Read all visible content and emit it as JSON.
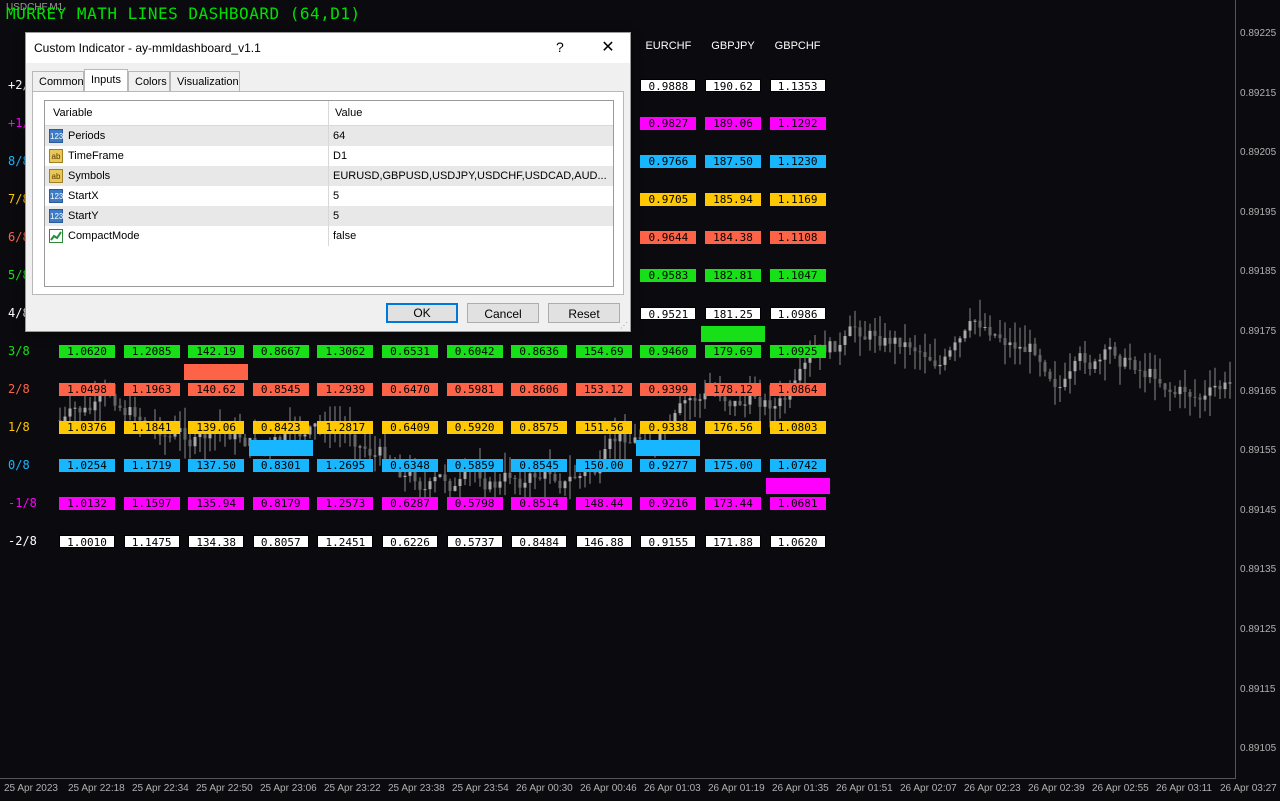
{
  "window": {
    "symbol_tag": "USDCHF,M1",
    "dashboard_title": "MURREY MATH LINES DASHBOARD (64,D1)"
  },
  "price_axis": [
    "0.89225",
    "0.89215",
    "0.89205",
    "0.89195",
    "0.89185",
    "0.89175",
    "0.89165",
    "0.89155",
    "0.89145",
    "0.89135",
    "0.89125",
    "0.89115",
    "0.89105"
  ],
  "time_axis": [
    "25 Apr 2023",
    "25 Apr 22:18",
    "25 Apr 22:34",
    "25 Apr 22:50",
    "25 Apr 23:06",
    "25 Apr 23:22",
    "25 Apr 23:38",
    "25 Apr 23:54",
    "26 Apr 00:30",
    "26 Apr 00:46",
    "26 Apr 01:03",
    "26 Apr 01:19",
    "26 Apr 01:35",
    "26 Apr 01:51",
    "26 Apr 02:07",
    "26 Apr 02:23",
    "26 Apr 02:39",
    "26 Apr 02:55",
    "26 Apr 03:11",
    "26 Apr 03:27"
  ],
  "dashboard": {
    "headers": [
      "",
      "",
      "",
      "",
      "",
      "",
      "",
      "",
      "",
      "EURCHF",
      "GBPJPY",
      "GBPCHF"
    ],
    "levels": [
      {
        "label": "+2/8",
        "color": "#ffffff",
        "bg": "#ffffff",
        "fg": "#000000",
        "values": [
          "",
          "",
          "",
          "",
          "",
          "",
          "",
          "",
          "",
          "0.9888",
          "190.62",
          "1.1353"
        ]
      },
      {
        "label": "+1/8",
        "color": "#ff00ff",
        "bg": "#ff00ff",
        "fg": "#000000",
        "values": [
          "",
          "",
          "",
          "",
          "",
          "",
          "",
          "",
          "",
          "0.9827",
          "189.06",
          "1.1292"
        ]
      },
      {
        "label": "8/8",
        "color": "#17b6ff",
        "bg": "#17b6ff",
        "fg": "#000000",
        "values": [
          "",
          "",
          "",
          "",
          "",
          "",
          "",
          "",
          "",
          "0.9766",
          "187.50",
          "1.1230"
        ]
      },
      {
        "label": "7/8",
        "color": "#ffc800",
        "bg": "#ffc800",
        "fg": "#000000",
        "values": [
          "",
          "",
          "",
          "",
          "",
          "",
          "",
          "",
          "",
          "0.9705",
          "185.94",
          "1.1169"
        ]
      },
      {
        "label": "6/8",
        "color": "#ff6347",
        "bg": "#ff6347",
        "fg": "#000000",
        "values": [
          "",
          "",
          "",
          "",
          "",
          "",
          "",
          "",
          "",
          "0.9644",
          "184.38",
          "1.1108"
        ]
      },
      {
        "label": "5/8",
        "color": "#18e018",
        "bg": "#18e018",
        "fg": "#000000",
        "values": [
          "",
          "",
          "",
          "",
          "",
          "",
          "",
          "",
          "",
          "0.9583",
          "182.81",
          "1.1047"
        ]
      },
      {
        "label": "4/8",
        "color": "#ffffff",
        "bg": "#ffffff",
        "fg": "#000000",
        "values": [
          "",
          "",
          "",
          "",
          "",
          "",
          "",
          "",
          "",
          "0.9521",
          "181.25",
          "1.0986"
        ]
      },
      {
        "label": "3/8",
        "color": "#18e018",
        "bg": "#18e018",
        "fg": "#000000",
        "values": [
          "1.0620",
          "1.2085",
          "142.19",
          "0.8667",
          "1.3062",
          "0.6531",
          "0.6042",
          "0.8636",
          "154.69",
          "0.9460",
          "179.69",
          "1.0925"
        ]
      },
      {
        "label": "2/8",
        "color": "#ff6347",
        "bg": "#ff6347",
        "fg": "#000000",
        "values": [
          "1.0498",
          "1.1963",
          "140.62",
          "0.8545",
          "1.2939",
          "0.6470",
          "0.5981",
          "0.8606",
          "153.12",
          "0.9399",
          "178.12",
          "1.0864"
        ]
      },
      {
        "label": "1/8",
        "color": "#ffc800",
        "bg": "#ffc800",
        "fg": "#000000",
        "values": [
          "1.0376",
          "1.1841",
          "139.06",
          "0.8423",
          "1.2817",
          "0.6409",
          "0.5920",
          "0.8575",
          "151.56",
          "0.9338",
          "176.56",
          "1.0803"
        ]
      },
      {
        "label": "0/8",
        "color": "#17b6ff",
        "bg": "#17b6ff",
        "fg": "#000000",
        "values": [
          "1.0254",
          "1.1719",
          "137.50",
          "0.8301",
          "1.2695",
          "0.6348",
          "0.5859",
          "0.8545",
          "150.00",
          "0.9277",
          "175.00",
          "1.0742"
        ]
      },
      {
        "label": "-1/8",
        "color": "#ff00ff",
        "bg": "#ff00ff",
        "fg": "#000000",
        "values": [
          "1.0132",
          "1.1597",
          "135.94",
          "0.8179",
          "1.2573",
          "0.6287",
          "0.5798",
          "0.8514",
          "148.44",
          "0.9216",
          "173.44",
          "1.0681"
        ]
      },
      {
        "label": "-2/8",
        "color": "#ffffff",
        "bg": "#ffffff",
        "fg": "#000000",
        "values": [
          "1.0010",
          "1.1475",
          "134.38",
          "0.8057",
          "1.2451",
          "0.6226",
          "0.5737",
          "0.8484",
          "146.88",
          "0.9155",
          "171.88",
          "1.0620"
        ]
      }
    ],
    "markers": [
      {
        "col": 2,
        "level": 8,
        "color": "#ff6347"
      },
      {
        "col": 3,
        "level": 10,
        "color": "#17b6ff"
      },
      {
        "col": 9,
        "level": 10,
        "color": "#17b6ff"
      },
      {
        "col": 10,
        "level": 7,
        "color": "#18e018"
      },
      {
        "col": 11,
        "level": 11,
        "color": "#ff00ff"
      }
    ]
  },
  "dialog": {
    "title": "Custom Indicator - ay-mmldashboard_v1.1",
    "help": "?",
    "close": "✕",
    "tabs": [
      "Common",
      "Inputs",
      "Colors",
      "Visualization"
    ],
    "active_tab": "Inputs",
    "table": {
      "col_variable": "Variable",
      "col_value": "Value",
      "rows": [
        {
          "icon": "num",
          "name": "Periods",
          "value": "64"
        },
        {
          "icon": "ab",
          "name": "TimeFrame",
          "value": "D1"
        },
        {
          "icon": "ab",
          "name": "Symbols",
          "value": "EURUSD,GBPUSD,USDJPY,USDCHF,USDCAD,AUD..."
        },
        {
          "icon": "num",
          "name": "StartX",
          "value": "5"
        },
        {
          "icon": "num",
          "name": "StartY",
          "value": "5"
        },
        {
          "icon": "bool",
          "name": "CompactMode",
          "value": "false"
        }
      ]
    },
    "buttons": {
      "ok": "OK",
      "cancel": "Cancel",
      "reset": "Reset"
    }
  }
}
